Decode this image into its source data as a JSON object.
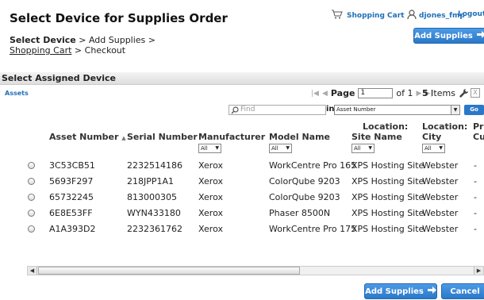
{
  "page": {
    "title": "Select Device for Supplies Order"
  },
  "header": {
    "cart_label": "Shopping Cart",
    "user_label": "djones_fmp",
    "logout_label": "Logout",
    "add_supplies_label": "Add Supplies"
  },
  "breadcrumb": {
    "current": "Select Device",
    "sep1": " > Add Supplies > ",
    "cart_link": "Shopping Cart",
    "sep2": " > Checkout"
  },
  "section": {
    "title": "Select Assigned Device"
  },
  "toolbar": {
    "tab_assets": "Assets",
    "page_label": "Page",
    "page_value": "1",
    "of_label": "of 1",
    "items_count": "5",
    "items_label": "Items"
  },
  "search": {
    "find_placeholder": "Find",
    "in_label": "in",
    "field_selected": "Asset Number",
    "go_label": "Go"
  },
  "columns": {
    "asset_number": "Asset Number",
    "serial_number": "Serial Number",
    "manufacturer": "Manufacturer",
    "model_name": "Model Name",
    "location_site_1": "Location:",
    "location_site_2": "Site Name",
    "location_city_1": "Location:",
    "location_city_2": "City",
    "extra_1": "Pri",
    "extra_2": "Cu",
    "filter_all": "All"
  },
  "rows": [
    {
      "asset": "3C53CB51",
      "serial": "2232514186",
      "mfr": "Xerox",
      "model": "WorkCentre Pro 165",
      "site": "XPS Hosting Site",
      "city": "Webster",
      "extra": "-"
    },
    {
      "asset": "5693F297",
      "serial": "218JPP1A1",
      "mfr": "Xerox",
      "model": "ColorQube 9203",
      "site": "XPS Hosting Site",
      "city": "Webster",
      "extra": "-"
    },
    {
      "asset": "65732245",
      "serial": "813000305",
      "mfr": "Xerox",
      "model": "ColorQube 9203",
      "site": "XPS Hosting Site",
      "city": "Webster",
      "extra": "-"
    },
    {
      "asset": "6E8E53FF",
      "serial": "WYN433180",
      "mfr": "Xerox",
      "model": "Phaser 8500N",
      "site": "XPS Hosting Site",
      "city": "Webster",
      "extra": "-"
    },
    {
      "asset": "A1A393D2",
      "serial": "2232361762",
      "mfr": "Xerox",
      "model": "WorkCentre Pro 175",
      "site": "XPS Hosting Site",
      "city": "Webster",
      "extra": "-"
    }
  ],
  "footer": {
    "add_supplies_label": "Add Supplies",
    "cancel_label": "Cancel"
  },
  "colors": {
    "accent": "#2a78c9",
    "link": "#1f6fb8"
  }
}
